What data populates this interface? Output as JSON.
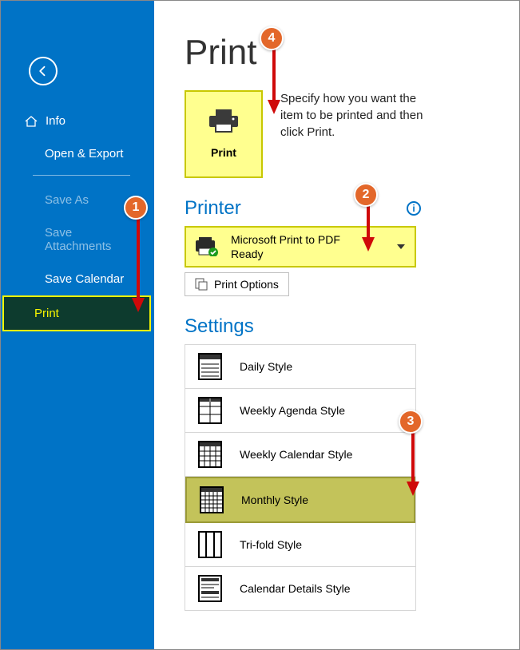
{
  "sidebar": {
    "items": [
      {
        "label": "Info"
      },
      {
        "label": "Open & Export"
      },
      {
        "label": "Save As"
      },
      {
        "label": "Save Attachments"
      },
      {
        "label": "Save Calendar"
      },
      {
        "label": "Print"
      }
    ]
  },
  "main": {
    "title": "Print",
    "print_button_label": "Print",
    "description": "Specify how you want the item to be printed and then click Print.",
    "printer_section": "Printer",
    "printer_name": "Microsoft Print to PDF",
    "printer_status": "Ready",
    "print_options_label": "Print Options",
    "settings_section": "Settings",
    "styles": [
      {
        "label": "Daily Style"
      },
      {
        "label": "Weekly Agenda Style"
      },
      {
        "label": "Weekly Calendar Style"
      },
      {
        "label": "Monthly Style"
      },
      {
        "label": "Tri-fold Style"
      },
      {
        "label": "Calendar Details Style"
      }
    ]
  },
  "callouts": {
    "c1": "1",
    "c2": "2",
    "c3": "3",
    "c4": "4"
  }
}
